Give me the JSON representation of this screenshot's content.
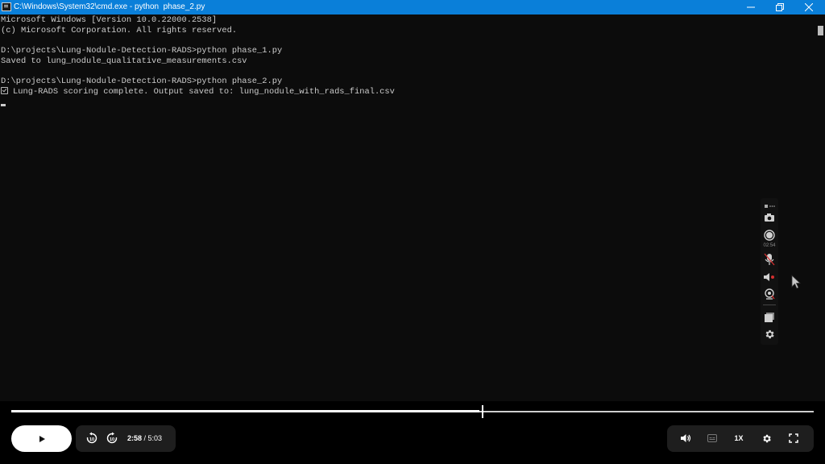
{
  "window": {
    "title": "C:\\Windows\\System32\\cmd.exe - python  phase_2.py",
    "buttons": [
      "minimize-icon",
      "restore-icon",
      "close-icon"
    ]
  },
  "terminal": {
    "lines": [
      "Microsoft Windows [Version 10.0.22000.2538]",
      "(c) Microsoft Corporation. All rights reserved.",
      "",
      "D:\\projects\\Lung-Nodule-Detection-RADS>python phase_1.py",
      "Saved to lung_nodule_qualitative_measurements.csv",
      "",
      "D:\\projects\\Lung-Nodule-Detection-RADS>python phase_2.py",
      "Lung-RADS scoring complete. Output saved to: lung_nodule_with_rads_final.csv"
    ],
    "check_icon_line": 7,
    "colors": {
      "background": "#0c0c0c",
      "text": "#cccccc"
    }
  },
  "capture_toolbar": {
    "timer": "02:54",
    "icons": [
      "more-icon",
      "camera-icon",
      "record-icon",
      "microphone-icon",
      "speaker-icon",
      "webcam-icon",
      "window-icon",
      "gear-icon"
    ]
  },
  "player": {
    "current_time": "2:58",
    "duration": "/ 5:03",
    "progress_fraction": 0.5875,
    "speed": "1X",
    "icons": [
      "play-icon",
      "rewind-10-icon",
      "forward-10-icon",
      "volume-icon",
      "captions-icon",
      "settings-icon",
      "fullscreen-icon"
    ]
  },
  "colors": {
    "titlebar": "#0a7fd9",
    "accent": "#ffffff"
  }
}
